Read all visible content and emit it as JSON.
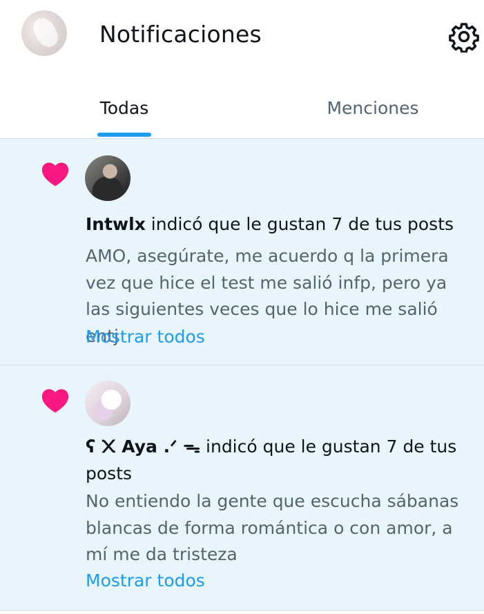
{
  "header": {
    "title": "Notificaciones",
    "settings_icon": "gear-icon"
  },
  "tabs": [
    {
      "label": "Todas",
      "active": true
    },
    {
      "label": "Menciones",
      "active": false
    }
  ],
  "colors": {
    "accent": "#1d9bf0",
    "heart": "#f91880",
    "unread_bg": "#e8f5fd",
    "secondary_text": "#536471"
  },
  "notifications": [
    {
      "icon": "heart-icon",
      "user": "Intwlx",
      "action": " indicó que le gustan 7 de tus posts",
      "post": "AMO, asegúrate, me acuerdo q la primera vez que hice el test me salió infp, pero ya las siguientes veces que lo hice me salió entj",
      "show_all": "Mostrar todos"
    },
    {
      "icon": "heart-icon",
      "user": "ʕ ᙭ Aya .ᐟ ᯓ",
      "action": " indicó que le gustan 7 de tus posts",
      "post": "No entiendo la gente que escucha sábanas blancas de forma romántica o con amor, a mí me da tristeza",
      "show_all": "Mostrar todos"
    }
  ]
}
